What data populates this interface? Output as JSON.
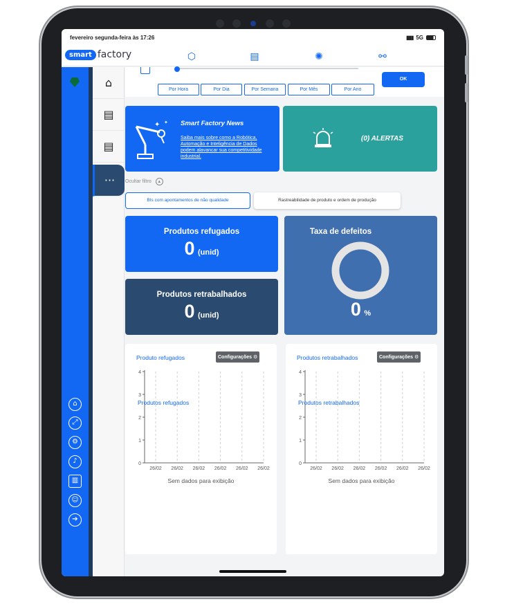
{
  "status": {
    "time": "fevereiro segunda-feira às 17:26",
    "network": "5G"
  },
  "brand": {
    "smart": "smart",
    "factory": "factory"
  },
  "filter": {
    "periods": [
      "Por Hora",
      "Por Dia",
      "Por Semana",
      "Por Mês",
      "Por Ano"
    ],
    "ok_label": "OK",
    "hide_label": "Ocultar filtro"
  },
  "news": {
    "title": "Smart Factory News",
    "text": "Saiba mais sobre como a Robótica, Automação e Inteligência de Dados podem alavancar sua competitividade industrial."
  },
  "alerts": {
    "label": "(0) ALERTAS"
  },
  "tabs": [
    "BIs com apontamentos de não qualidade",
    "Rastreabilidade de produto e ordem de produção"
  ],
  "kpis": {
    "refugados": {
      "title": "Produtos refugados",
      "value": "0",
      "unit": "(unid)"
    },
    "retrabalhados": {
      "title": "Produtos retrabalhados",
      "value": "0",
      "unit": "(unid)"
    },
    "defeitos": {
      "title": "Taxa de defeitos",
      "value": "0",
      "unit": "%"
    }
  },
  "panels": [
    {
      "title": "Produto refugados",
      "config_label": "Configurações",
      "empty_text": "Sem dados para exibição"
    },
    {
      "title": "Produtos retrabalhados",
      "config_label": "Configurações",
      "empty_text": "Sem dados para exibição"
    }
  ],
  "chart_data": [
    {
      "type": "line",
      "title": "",
      "series": [
        {
          "name": "Produtos refugados",
          "values": []
        }
      ],
      "x": [
        "26/02",
        "26/02",
        "26/02",
        "26/02",
        "26/02",
        "26/02"
      ],
      "ylim": [
        0,
        4
      ],
      "yticks": [
        "0",
        "1",
        "2",
        "3",
        "4"
      ],
      "grid": true
    },
    {
      "type": "line",
      "title": "",
      "series": [
        {
          "name": "Produtos retrabalhados",
          "values": []
        }
      ],
      "x": [
        "26/02",
        "26/02",
        "26/02",
        "26/02",
        "26/02",
        "26/02"
      ],
      "ylim": [
        0,
        4
      ],
      "yticks": [
        "0",
        "1",
        "2",
        "3",
        "4"
      ],
      "grid": true
    }
  ],
  "colors": {
    "primary": "#1268f3",
    "dark": "#2b4a70",
    "teal": "#2ba19d",
    "defects": "#3f6fae"
  }
}
